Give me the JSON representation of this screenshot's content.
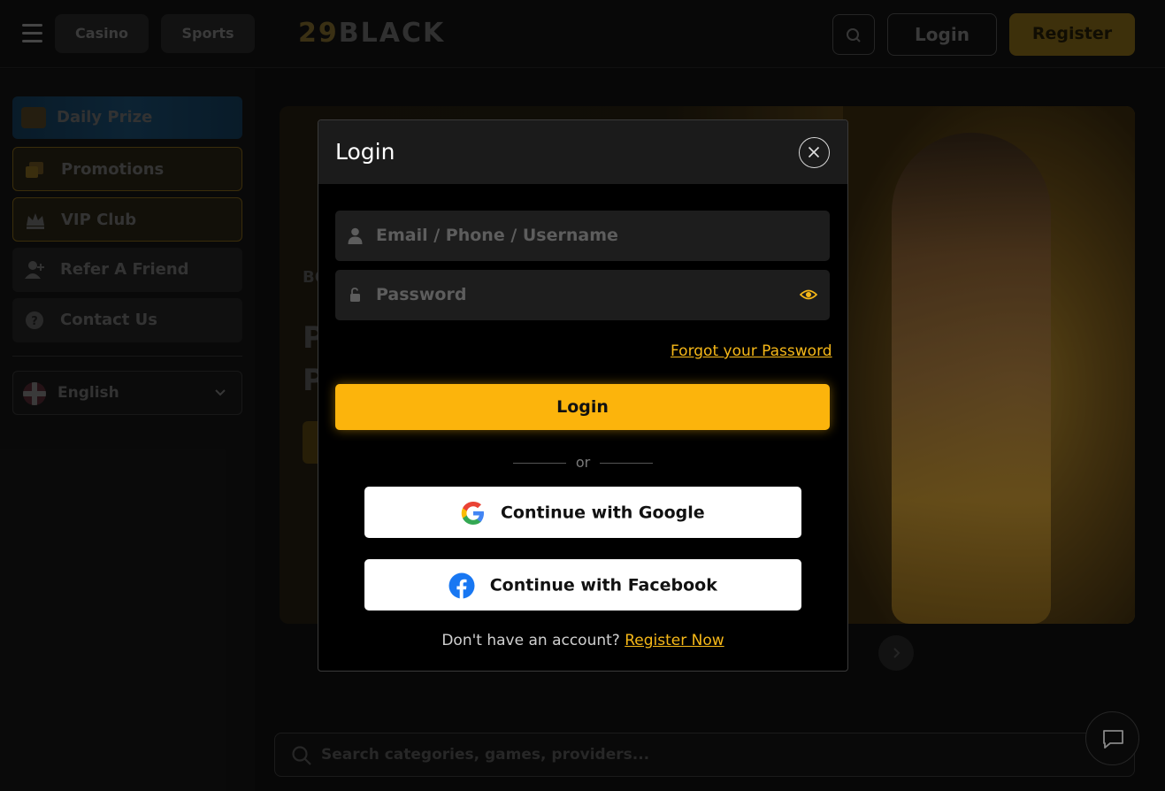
{
  "header": {
    "nav": [
      "Casino",
      "Sports"
    ],
    "logo_num": "29",
    "logo_word": "BLACK",
    "login_label": "Login",
    "register_label": "Register"
  },
  "sidebar": {
    "items": [
      {
        "label": "Daily Prize",
        "icon": "treasure-chest-icon"
      },
      {
        "label": "Promotions",
        "icon": "promotions-icon"
      },
      {
        "label": "VIP Club",
        "icon": "crown-icon"
      },
      {
        "label": "Refer A Friend",
        "icon": "add-user-icon"
      },
      {
        "label": "Contact Us",
        "icon": "question-icon"
      }
    ],
    "language": "English"
  },
  "banner": {
    "small_text": "BO",
    "big_line1": "P",
    "big_line2": "P"
  },
  "search": {
    "placeholder": "Search categories, games, providers..."
  },
  "modal": {
    "title": "Login",
    "username_placeholder": "Email / Phone / Username",
    "password_placeholder": "Password",
    "forgot_label": "Forgot your Password",
    "login_label": "Login",
    "or_label": "or",
    "google_label": "Continue with Google",
    "facebook_label": "Continue with Facebook",
    "signup_prompt": "Don't have an account?",
    "signup_link": "Register Now"
  },
  "colors": {
    "accent": "#fcb40c",
    "modal_bg": "#000000",
    "field_bg": "#1d1d1d"
  }
}
